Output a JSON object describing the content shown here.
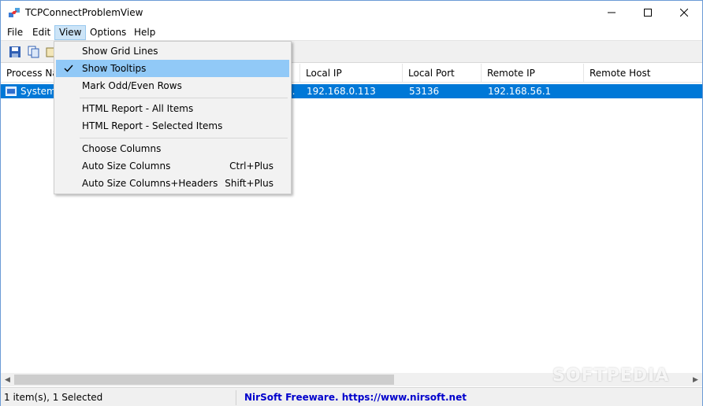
{
  "window": {
    "title": "TCPConnectProblemView"
  },
  "menubar": {
    "items": [
      "File",
      "Edit",
      "View",
      "Options",
      "Help"
    ]
  },
  "toolbar": {
    "buttons": [
      "save-icon",
      "copy-icon",
      "properties-icon"
    ]
  },
  "list": {
    "columns": [
      "Process Name",
      "",
      "Local IP",
      "Local Port",
      "Remote IP",
      "Remote Host"
    ],
    "rows": [
      {
        "process_name": "System I",
        "hidden_cell": "...",
        "local_ip": "192.168.0.113",
        "local_port": "53136",
        "remote_ip": "192.168.56.1",
        "remote_host": ""
      }
    ],
    "selected_row": 0
  },
  "view_menu": {
    "items": [
      {
        "label": "Show Grid Lines",
        "shortcut": "",
        "checked": false
      },
      {
        "label": "Show Tooltips",
        "shortcut": "",
        "checked": true
      },
      {
        "label": "Mark Odd/Even Rows",
        "shortcut": "",
        "checked": false
      },
      {
        "label": "HTML Report - All Items",
        "shortcut": "",
        "checked": false
      },
      {
        "label": "HTML Report - Selected Items",
        "shortcut": "",
        "checked": false
      },
      {
        "label": "Choose Columns",
        "shortcut": "",
        "checked": false
      },
      {
        "label": "Auto Size Columns",
        "shortcut": "Ctrl+Plus",
        "checked": false
      },
      {
        "label": "Auto Size Columns+Headers",
        "shortcut": "Shift+Plus",
        "checked": false
      }
    ]
  },
  "statusbar": {
    "count": "1 item(s), 1 Selected",
    "credit": "NirSoft Freeware. https://www.nirsoft.net"
  },
  "watermark": "SOFTPEDIA",
  "colors": {
    "selection": "#0078d7",
    "menu_highlight": "#91c9f7",
    "active_menu": "#cce4f7",
    "link": "#0000cc"
  }
}
